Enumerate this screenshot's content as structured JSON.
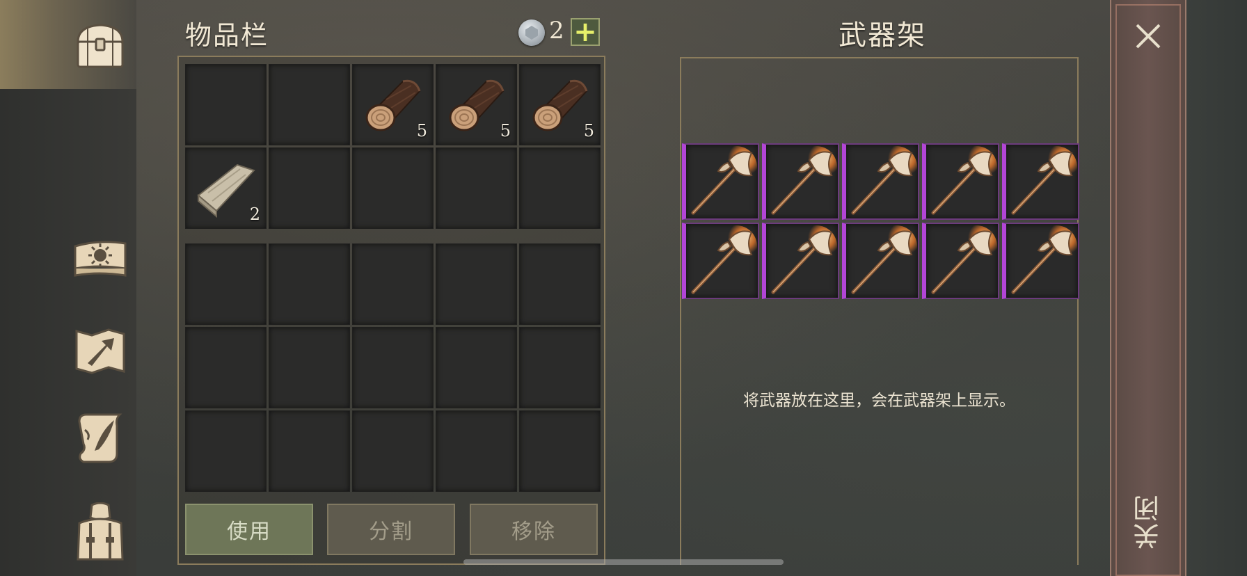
{
  "sidebar": {
    "items": [
      {
        "name": "chest-icon",
        "active": true
      },
      {
        "name": "sun-book-icon",
        "active": false
      },
      {
        "name": "map-arrow-icon",
        "active": false
      },
      {
        "name": "scroll-quill-icon",
        "active": false
      },
      {
        "name": "character-backpack-icon",
        "active": false
      }
    ]
  },
  "inventory": {
    "title": "物品栏",
    "currency_icon": "silver-coin-icon",
    "currency_value": "2",
    "add_label": "+",
    "upper_slots": [
      {
        "item": "",
        "qty": ""
      },
      {
        "item": "",
        "qty": ""
      },
      {
        "item": "log",
        "qty": "5"
      },
      {
        "item": "log",
        "qty": "5"
      },
      {
        "item": "log",
        "qty": "5"
      },
      {
        "item": "plank",
        "qty": "2"
      },
      {
        "item": "",
        "qty": ""
      },
      {
        "item": "",
        "qty": ""
      },
      {
        "item": "",
        "qty": ""
      },
      {
        "item": "",
        "qty": ""
      }
    ],
    "lower_slot_count": 15
  },
  "actions": {
    "use_label": "使用",
    "split_label": "分割",
    "remove_label": "移除"
  },
  "weapon_rack": {
    "title": "武器架",
    "slots": [
      "flaming-axe",
      "flaming-axe",
      "flaming-axe",
      "flaming-axe",
      "flaming-axe",
      "flaming-axe",
      "flaming-axe",
      "flaming-axe",
      "flaming-axe",
      "flaming-axe"
    ],
    "hint": "将武器放在这里，会在武器架上显示。",
    "rarity_color": "#b245d6"
  },
  "close": {
    "label": "关闭",
    "icon": "close-icon"
  },
  "colors": {
    "panel_border": "#8b7c5c",
    "plus_green": "#e6ef6a",
    "use_button": "#6e7658"
  }
}
